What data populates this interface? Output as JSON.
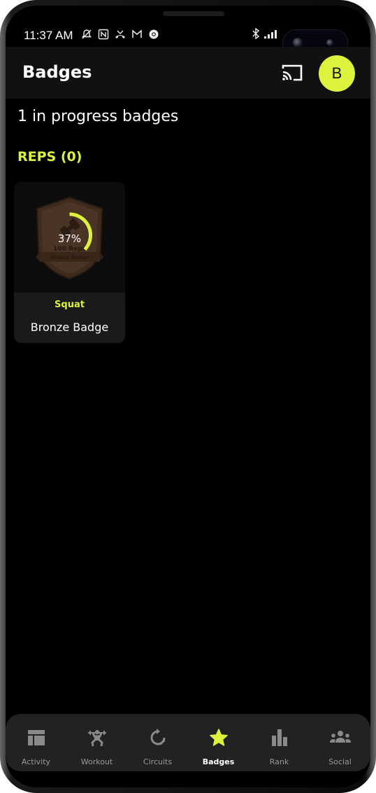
{
  "status_bar": {
    "time": "11:37 AM",
    "left_icons": [
      "mute-icon",
      "nfc-icon",
      "missed-call-icon",
      "gmail-icon",
      "chrome-icon"
    ],
    "right_icons": [
      "bluetooth-icon",
      "signal-icon",
      "battery-icon"
    ]
  },
  "app_bar": {
    "title": "Badges",
    "cast_icon": "cast-icon",
    "avatar_initial": "B"
  },
  "summary": "1 in progress badges",
  "categories": [
    {
      "label": "REPS (0)",
      "badges": [
        {
          "exercise": "Squat",
          "name": "Bronze Badge",
          "progress_percent": 37,
          "progress_text": "37%",
          "target_text": "100 Reps",
          "ribbon_text": "Bronze Badge"
        }
      ]
    }
  ],
  "bottom_nav": {
    "items": [
      {
        "label": "Activity",
        "icon": "dashboard-icon",
        "active": false
      },
      {
        "label": "Workout",
        "icon": "weightlifter-icon",
        "active": false
      },
      {
        "label": "Circuits",
        "icon": "circular-arrow-icon",
        "active": false
      },
      {
        "label": "Badges",
        "icon": "star-icon",
        "active": true
      },
      {
        "label": "Rank",
        "icon": "bar-chart-icon",
        "active": false
      },
      {
        "label": "Social",
        "icon": "group-icon",
        "active": false
      }
    ]
  },
  "colors": {
    "accent": "#dcf23c",
    "background": "#000000",
    "app_bar": "#111111",
    "card": "#1a1a1a",
    "nav_bg": "#222224",
    "nav_inactive": "#8a8a8a",
    "bronze": "#4a3426"
  }
}
